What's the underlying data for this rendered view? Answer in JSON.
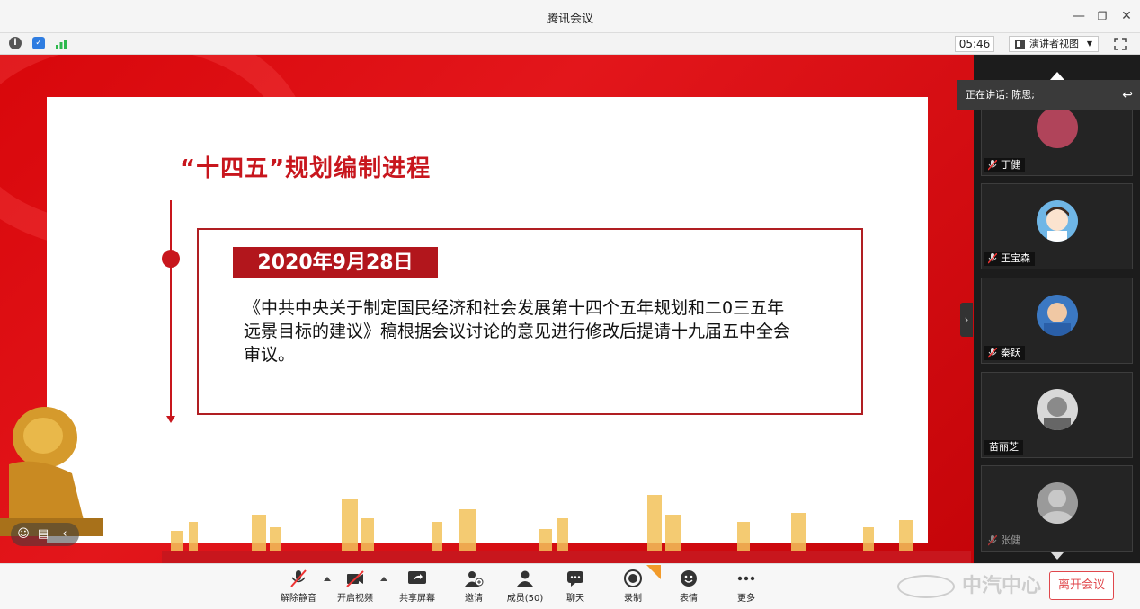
{
  "window": {
    "title": "腾讯会议"
  },
  "toolbar": {
    "timer": "05:46",
    "view_mode": "演讲者视图"
  },
  "slide": {
    "title": "“十四五”规划编制进程",
    "date": "2020年9月28日",
    "text": "《中共中央关于制定国民经济和社会发展第十四个五年规划和二0三五年远景目标的建议》稿根据会议讨论的意见进行修改后提请十九届五中全会审议。"
  },
  "side_panel": {
    "speaking_label": "正在讲话: 陈思;",
    "participants": [
      {
        "name": "丁健",
        "avatar_color": "#b0445a",
        "muted": true
      },
      {
        "name": "王宝森",
        "avatar_color": "#6fb6e6",
        "muted": true
      },
      {
        "name": "秦跃",
        "avatar_color": "#3b78c2",
        "muted": true
      },
      {
        "name": "苗丽芝",
        "avatar_color": "#bfbfbf",
        "muted": false
      },
      {
        "name": "张健",
        "avatar_color": "#9a9a9a",
        "muted": true
      }
    ]
  },
  "controls": {
    "unmute": "解除静音",
    "start_video": "开启视频",
    "share_screen": "共享屏幕",
    "invite": "邀请",
    "members": "成员(50)",
    "chat": "聊天",
    "record": "录制",
    "reactions": "表情",
    "more": "更多",
    "leave": "离开会议",
    "watermark": "中汽中心"
  },
  "colors": {
    "accent_red": "#c8161d",
    "leave_red": "#e0474c"
  }
}
